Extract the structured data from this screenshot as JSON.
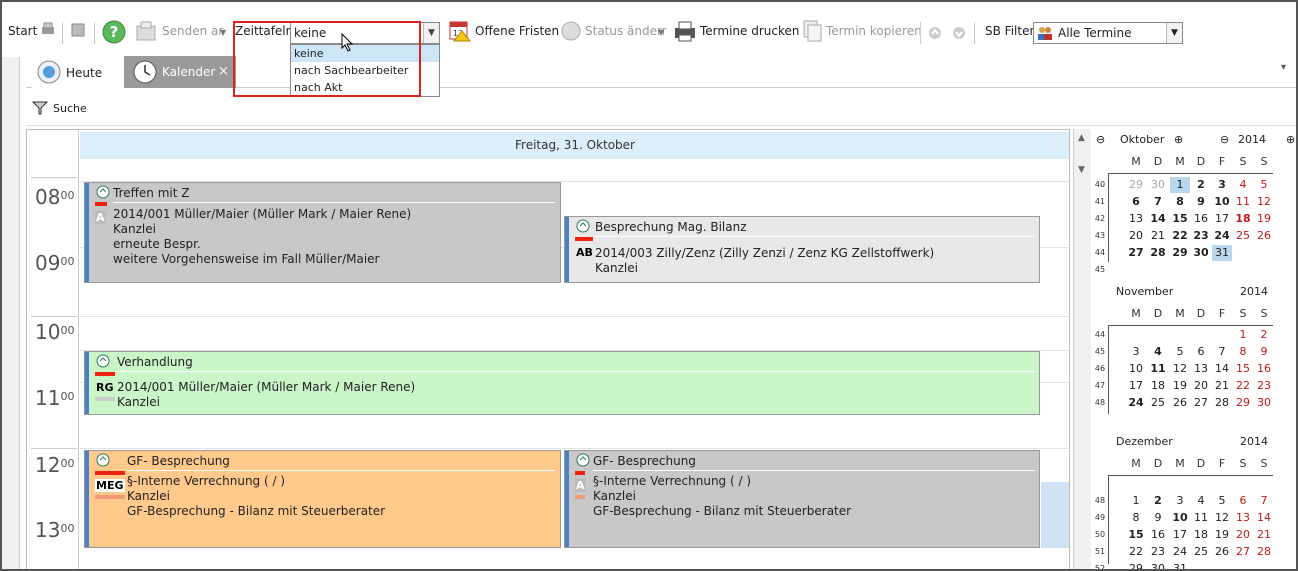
{
  "toolbar": {
    "start": "Start",
    "senden": "Senden ar",
    "zeittafeln": "Zeittafeln",
    "zeittafeln_value": "keine",
    "dropdown_options": [
      "keine",
      "nach Sachbearbeiter",
      "nach Akt"
    ],
    "offene_fristen": "Offene Fristen",
    "status_aendern": "Status änderr",
    "termine_drucken": "Termine drucken",
    "termin_kopieren": "Termin kopieren",
    "sb_filter": "SB Filter",
    "sb_filter_value": "Alle Termine"
  },
  "tabs": {
    "heute": "Heute",
    "kalender": "Kalender",
    "close": "×",
    "menu": "▾"
  },
  "subbar": {
    "suche": "Suche"
  },
  "calendar": {
    "day": "Freitag, 31. Oktober",
    "hours": [
      {
        "h": "08",
        "m": "00"
      },
      {
        "h": "09",
        "m": "00"
      },
      {
        "h": "10",
        "m": "00"
      },
      {
        "h": "11",
        "m": "00"
      },
      {
        "h": "12",
        "m": "00"
      },
      {
        "h": "13",
        "m": "00"
      }
    ]
  },
  "appointments": [
    {
      "title": "Treffen mit Z",
      "badge": "A",
      "lines": [
        "2014/001 Müller/Maier (Müller Mark / Maier Rene)",
        "Kanzlei",
        "erneute Bespr.",
        "weitere Vorgehensweise im Fall Müller/Maier"
      ],
      "color": "#c8c8c8"
    },
    {
      "title": "Besprechung Mag. Bilanz",
      "badge": "AB",
      "lines": [
        "2014/003 Zilly/Zenz (Zilly Zenzi / Zenz KG Zellstoffwerk)",
        "Kanzlei"
      ],
      "color": "#e8e8e8"
    },
    {
      "title": "Verhandlung",
      "badge": "RG",
      "lines": [
        "2014/001 Müller/Maier (Müller Mark / Maier Rene)",
        "Kanzlei"
      ],
      "color": "#c9f5c9"
    },
    {
      "title": "GF- Besprechung",
      "badge": "MEG",
      "lines": [
        "§-Interne Verrechnung ( / )",
        "Kanzlei",
        "GF-Besprechung - Bilanz mit Steuerberater"
      ],
      "color": "#fec98a"
    },
    {
      "title": "GF- Besprechung",
      "badge": "A",
      "lines": [
        "§-Interne Verrechnung ( / )",
        "Kanzlei",
        "GF-Besprechung - Bilanz mit Steuerberater"
      ],
      "color": "#c8c8c8"
    }
  ],
  "minical": {
    "nav_prev": "⊖",
    "nav_next": "⊕",
    "dayheaders": [
      "M",
      "D",
      "M",
      "D",
      "F",
      "S",
      "S"
    ],
    "oktober": {
      "name": "Oktober",
      "year": "2014",
      "weeks": [
        "40",
        "41",
        "42",
        "43",
        "44",
        "45"
      ],
      "days": [
        [
          "29",
          "30",
          "1",
          "2",
          "3",
          "4",
          "5"
        ],
        [
          "6",
          "7",
          "8",
          "9",
          "10",
          "11",
          "12"
        ],
        [
          "13",
          "14",
          "15",
          "16",
          "17",
          "18",
          "19"
        ],
        [
          "20",
          "21",
          "22",
          "23",
          "24",
          "25",
          "26"
        ],
        [
          "27",
          "28",
          "29",
          "30",
          "31",
          "",
          ""
        ]
      ]
    },
    "november": {
      "name": "November",
      "year": "2014",
      "weeks": [
        "44",
        "45",
        "46",
        "47",
        "48"
      ],
      "days": [
        [
          "",
          "",
          "",
          "",
          "",
          "1",
          "2"
        ],
        [
          "3",
          "4",
          "5",
          "6",
          "7",
          "8",
          "9"
        ],
        [
          "10",
          "11",
          "12",
          "13",
          "14",
          "15",
          "16"
        ],
        [
          "17",
          "18",
          "19",
          "20",
          "21",
          "22",
          "23"
        ],
        [
          "24",
          "25",
          "26",
          "27",
          "28",
          "29",
          "30"
        ]
      ]
    },
    "dezember": {
      "name": "Dezember",
      "year": "2014",
      "weeks": [
        "48",
        "49",
        "50",
        "51",
        "52"
      ],
      "days": [
        [
          "1",
          "2",
          "3",
          "4",
          "5",
          "6",
          "7"
        ],
        [
          "8",
          "9",
          "10",
          "11",
          "12",
          "13",
          "14"
        ],
        [
          "15",
          "16",
          "17",
          "18",
          "19",
          "20",
          "21"
        ],
        [
          "22",
          "23",
          "24",
          "25",
          "26",
          "27",
          "28"
        ],
        [
          "29",
          "30",
          "31",
          "",
          "",
          "",
          ""
        ]
      ]
    }
  }
}
